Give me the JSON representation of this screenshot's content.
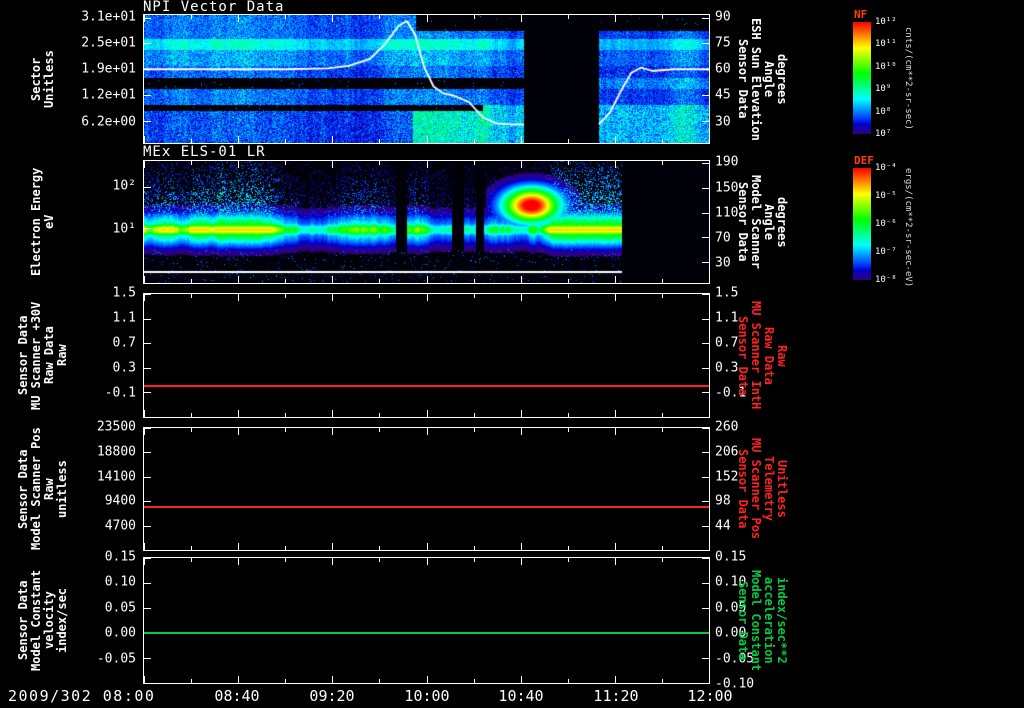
{
  "app": {
    "background": "#000000",
    "text_color": "#ffffff"
  },
  "time_axis": {
    "start_label": "2009/302 08:00",
    "labels": [
      "08:40",
      "09:20",
      "10:00",
      "10:40",
      "11:20",
      "12:00"
    ],
    "hours": [
      8.0,
      8.667,
      9.333,
      10.0,
      10.667,
      11.333,
      12.0
    ]
  },
  "colorbars": [
    {
      "name": "NF",
      "title_color": "#ff4000",
      "ticks": [
        "10¹²",
        "10¹¹",
        "10¹⁰",
        "10⁹",
        "10⁸",
        "10⁷"
      ],
      "units": "cnts/(cm**2-sr-sec)"
    },
    {
      "name": "DEF",
      "title_color": "#ff4000",
      "ticks": [
        "10⁻⁴",
        "10⁻⁵",
        "10⁻⁶",
        "10⁻⁷",
        "10⁻⁸"
      ],
      "units": "ergs/(cm**2-sr-sec-eV)"
    }
  ],
  "chart_data": [
    {
      "type": "heatmap",
      "title": "NPI Vector Data",
      "x_range_hours": [
        8,
        12
      ],
      "black_gap_hours": [
        10.69,
        11.22
      ],
      "left_axis": {
        "label_lines": [
          "Sector",
          "Unitless"
        ],
        "ticks": [
          "3.1e+01",
          "2.5e+01",
          "1.9e+01",
          "1.2e+01",
          "6.2e+00"
        ],
        "fracs": [
          0.02,
          0.222,
          0.424,
          0.626,
          0.828
        ],
        "range": [
          33,
          0
        ]
      },
      "right_axis": {
        "label_lines": [
          "Sensor Data",
          "ESH Sun Elevation",
          "Angle",
          "degrees"
        ],
        "ticks": [
          "90",
          "75",
          "60",
          "45",
          "30"
        ],
        "fracs": [
          0.02,
          0.222,
          0.424,
          0.626,
          0.828
        ],
        "range": [
          91.5,
          17.2
        ],
        "color": "#ffffff"
      },
      "overlay_line": {
        "name": "ESH Sun Elevation Angle",
        "color": "#ffffff",
        "axis_range": [
          91.5,
          17.2
        ],
        "segments": [
          [
            [
              8.0,
              60
            ],
            [
              9.0,
              60
            ],
            [
              9.3,
              60.5
            ],
            [
              9.45,
              62
            ],
            [
              9.6,
              66
            ],
            [
              9.7,
              74
            ],
            [
              9.8,
              85
            ],
            [
              9.86,
              88
            ],
            [
              9.92,
              80
            ],
            [
              9.98,
              62
            ],
            [
              10.05,
              50
            ],
            [
              10.12,
              46
            ],
            [
              10.2,
              44.5
            ],
            [
              10.3,
              41
            ],
            [
              10.4,
              32
            ],
            [
              10.5,
              28.5
            ],
            [
              10.6,
              28
            ],
            [
              10.69,
              28
            ]
          ],
          [
            [
              11.22,
              28
            ],
            [
              11.3,
              35
            ],
            [
              11.38,
              48
            ],
            [
              11.45,
              58
            ],
            [
              11.52,
              61
            ],
            [
              11.6,
              59
            ],
            [
              11.75,
              60
            ],
            [
              12.0,
              60
            ]
          ]
        ]
      }
    },
    {
      "type": "heatmap",
      "title": "MEx ELS-01 LR",
      "x_range_hours": [
        8,
        12
      ],
      "data_end_hour": 11.38,
      "gap_hours": [
        [
          9.78,
          9.86
        ],
        [
          10.18,
          10.26
        ],
        [
          10.35,
          10.4
        ]
      ],
      "left_axis": {
        "label_lines": [
          "Electron Energy",
          "eV"
        ],
        "ticks": [
          "10²",
          "10¹"
        ],
        "fracs": [
          0.21,
          0.553
        ],
        "range_log10_ev": [
          2.6,
          -0.3
        ]
      },
      "right_axis": {
        "label_lines": [
          "Sensor Data",
          "Model Scanner",
          "Angle",
          "degrees"
        ],
        "ticks": [
          "190",
          "150",
          "110",
          "70",
          "30"
        ],
        "fracs": [
          0.02,
          0.222,
          0.424,
          0.626,
          0.828
        ],
        "range": [
          194,
          26
        ],
        "color": "#ffffff"
      }
    },
    {
      "type": "line",
      "left_axis": {
        "label_lines": [
          "Sensor Data",
          "MU Scanner +30V",
          "Raw Data",
          "Raw"
        ],
        "ticks": [
          "1.5",
          "1.1",
          "0.7",
          "0.3",
          "-0.1"
        ],
        "fracs": [
          0,
          0.2,
          0.4,
          0.6,
          0.8
        ],
        "range": [
          1.5,
          -0.5
        ]
      },
      "right_axis": {
        "label_lines": [
          "Sensor Data",
          "MU Scanner IntH",
          "Raw Data",
          "Raw"
        ],
        "ticks": [
          "1.5",
          "1.1",
          "0.7",
          "0.3",
          "-0.1"
        ],
        "fracs": [
          0,
          0.2,
          0.4,
          0.6,
          0.8
        ],
        "range": [
          1.5,
          -0.5
        ],
        "color": "#ff2222"
      },
      "series": [
        {
          "name": "MU Scanner +30V Raw",
          "color": "#ff2222",
          "value": 0.0
        }
      ]
    },
    {
      "type": "line",
      "left_axis": {
        "label_lines": [
          "Sensor Data",
          "Model Scanner Pos",
          "Raw",
          "unitless"
        ],
        "ticks": [
          "23500",
          "18800",
          "14100",
          "9400",
          "4700"
        ],
        "fracs": [
          0,
          0.2,
          0.4,
          0.6,
          0.8
        ],
        "range": [
          23500,
          0
        ]
      },
      "right_axis": {
        "label_lines": [
          "Sensor Data",
          "MU Scanner Pos",
          "Telemetry",
          "Unitless"
        ],
        "ticks": [
          "260",
          "206",
          "152",
          "98",
          "44"
        ],
        "fracs": [
          0,
          0.2,
          0.4,
          0.6,
          0.8
        ],
        "range": [
          260,
          -10
        ],
        "color": "#ff2222"
      },
      "series": [
        {
          "name": "Model Scanner Pos Raw",
          "color": "#ff2222",
          "value": 8340
        }
      ]
    },
    {
      "type": "line",
      "left_axis": {
        "label_lines": [
          "Sensor Data",
          "Model Constant",
          "velocity",
          "index/sec"
        ],
        "ticks": [
          "0.15",
          "0.10",
          "0.05",
          "0.00",
          "-0.05"
        ],
        "fracs": [
          0,
          0.2,
          0.4,
          0.6,
          0.8
        ],
        "range": [
          0.15,
          -0.1
        ]
      },
      "right_axis": {
        "label_lines": [
          "Sensor Data",
          "Model Constant",
          "acceleration",
          "index/sec**2"
        ],
        "ticks": [
          "0.15",
          "0.10",
          "0.05",
          "0.00",
          "-0.05",
          "-0.10"
        ],
        "fracs": [
          0,
          0.2,
          0.4,
          0.6,
          0.8,
          1.0
        ],
        "range": [
          0.15,
          -0.1
        ],
        "color": "#00cc44"
      },
      "series": [
        {
          "name": "Model Constant velocity",
          "color": "#00cc44",
          "value": 0.0
        }
      ]
    }
  ]
}
